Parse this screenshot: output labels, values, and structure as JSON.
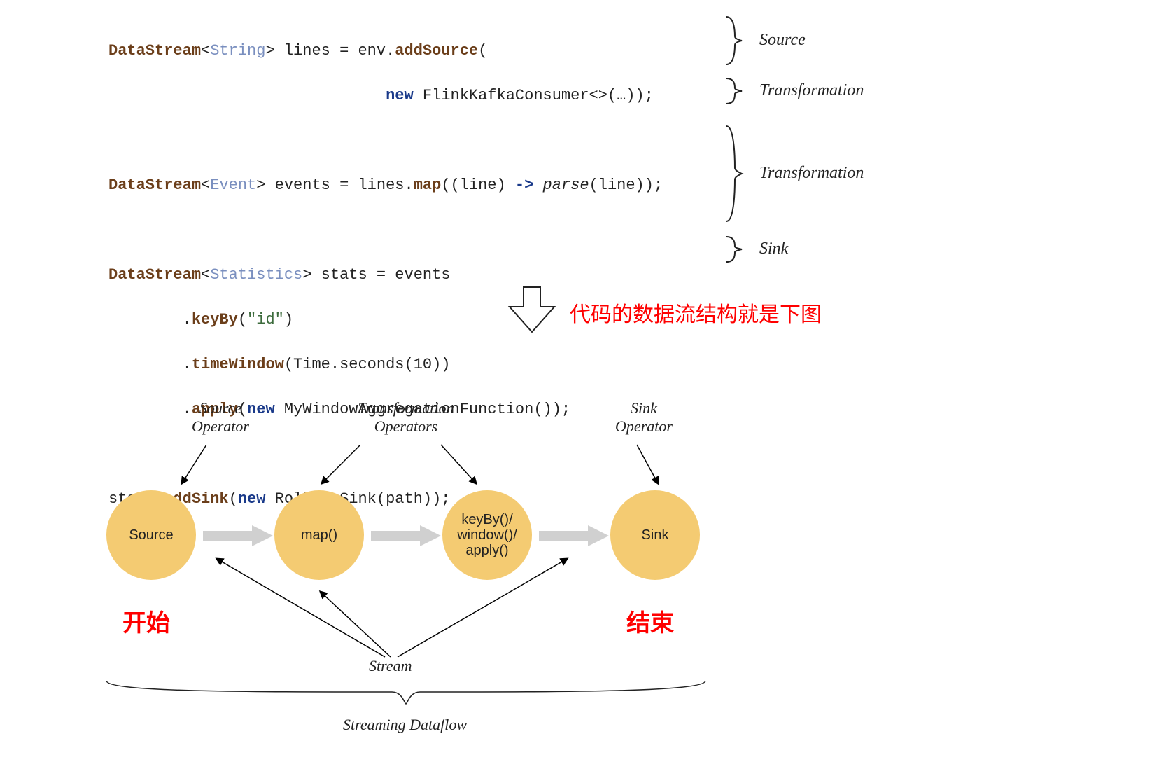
{
  "code": {
    "line1": {
      "cls": "DataStream",
      "gen": "String",
      "rest": "> lines = env.",
      "m": "addSource",
      "tail": "("
    },
    "line2": {
      "indent1": "                              ",
      "kw": "new",
      "rest": " FlinkKafkaConsumer<>(…));"
    },
    "line3": "",
    "line4": {
      "cls": "DataStream",
      "gen": "Event",
      "rest": "> events = lines.",
      "m": "map",
      "afterM": "((line) ",
      "arrow": "->",
      "parsePre": " ",
      "parse": "parse",
      "parseTail": "(line));"
    },
    "line5": "",
    "line6": {
      "cls": "DataStream",
      "gen": "Statistics",
      "rest": "> stats = events"
    },
    "line7": {
      "indent": "        .",
      "m": "keyBy",
      "lp": "(",
      "str": "\"id\"",
      "rp": ")"
    },
    "line8": {
      "indent": "        .",
      "m": "timeWindow",
      "rest": "(Time.seconds(10))"
    },
    "line9": {
      "indent": "        .",
      "m": "apply",
      "lp": "(",
      "kw": "new",
      "rest": " MyWindowAggregationFunction());"
    },
    "line10": "",
    "line11": {
      "pre": "stats.",
      "m": "addSink",
      "lp": "(",
      "kw": "new",
      "rest": " RollingSink(path));"
    }
  },
  "labels": {
    "r1": "Source",
    "r2": "Transformation",
    "r3": "Transformation",
    "r4": "Sink"
  },
  "annotations": {
    "red_arrow": "代码的数据流结构就是下图",
    "start": "开始",
    "end": "结束"
  },
  "diagram": {
    "nodes": {
      "source": "Source",
      "map": "map()",
      "keyby": "keyBy()/\nwindow()/\napply()",
      "sink": "Sink"
    },
    "opLabels": {
      "sourceOp": "Source\nOperator",
      "transOp": "Transformation\nOperators",
      "sinkOp": "Sink\nOperator"
    },
    "stream": "Stream",
    "dataflow": "Streaming Dataflow"
  }
}
